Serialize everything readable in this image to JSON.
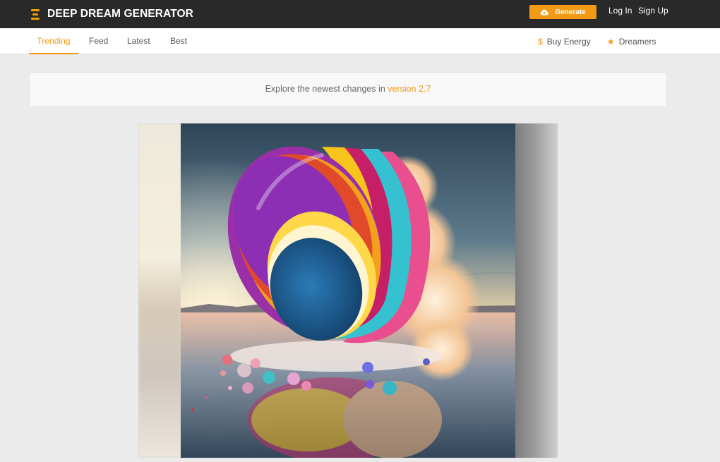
{
  "header": {
    "logo_text": "DEEP DREAM GENERATOR",
    "generate_label": "Generate",
    "login_label": "Log In",
    "signup_label": "Sign Up",
    "accent_color": "#f29a14"
  },
  "nav": {
    "tabs": [
      {
        "label": "Trending",
        "active": true
      },
      {
        "label": "Feed",
        "active": false
      },
      {
        "label": "Latest",
        "active": false
      },
      {
        "label": "Best",
        "active": false
      }
    ],
    "buy_energy_label": "Buy Energy",
    "buy_energy_icon": "$",
    "dreamers_label": "Dreamers",
    "dreamers_icon": "★"
  },
  "notice": {
    "text": "Explore the newest changes in ",
    "link_text": "version 2.7"
  }
}
